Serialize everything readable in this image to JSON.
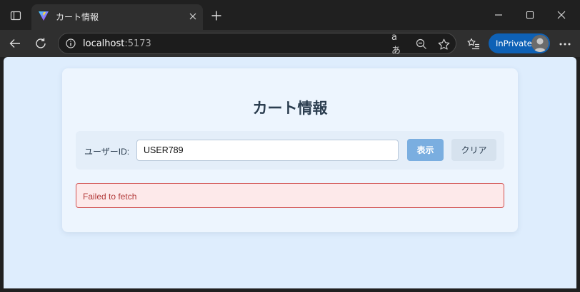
{
  "browser": {
    "tab": {
      "title": "カート情報",
      "favicon": "vite-logo-icon"
    },
    "address": {
      "host": "localhost",
      "port": ":5173"
    },
    "toolbar": {
      "translate_glyph": "aあ",
      "inprivate_label": "InPrivate"
    },
    "colors": {
      "frame": "#202020",
      "toolbar": "#2f2f2f",
      "inprivate": "#0e61b6"
    }
  },
  "page": {
    "title": "カート情報",
    "form": {
      "user_label": "ユーザーID:",
      "user_value": "USER789",
      "show_label": "表示",
      "clear_label": "クリア"
    },
    "error": {
      "message": "Failed to fetch"
    },
    "colors": {
      "background": "#deedfd",
      "card": "#edf5fe",
      "show_button": "#7aaee0",
      "error_border": "#d15252",
      "error_bg": "#fde9ea"
    }
  }
}
